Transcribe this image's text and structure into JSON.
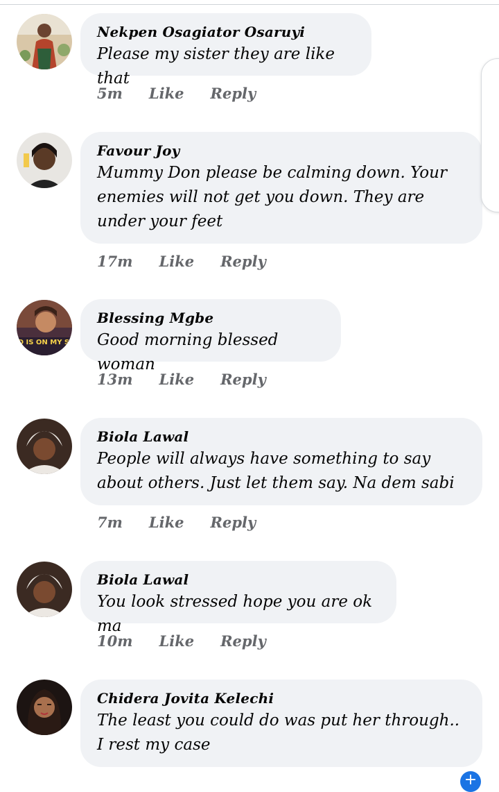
{
  "comments": [
    {
      "author": "Nekpen Osagiator Osaruyi",
      "text": "Please my sister they are like that",
      "time": "5m",
      "like": "Like",
      "reply": "Reply"
    },
    {
      "author": "Favour Joy",
      "text": "Mummy Don please be calming down. Your enemies will not get you down. They are under your feet",
      "time": "17m",
      "like": "Like",
      "reply": "Reply"
    },
    {
      "author": "Blessing Mgbe",
      "text": "Good morning blessed woman",
      "time": "13m",
      "like": "Like",
      "reply": "Reply",
      "avatar_caption": "GOD IS ON MY SIDE"
    },
    {
      "author": "Biola Lawal",
      "text": "People will always have something to say about others. Just let them say. Na dem sabi",
      "time": "7m",
      "like": "Like",
      "reply": "Reply"
    },
    {
      "author": "Biola Lawal",
      "text": "You look stressed hope you are ok ma",
      "time": "10m",
      "like": "Like",
      "reply": "Reply"
    },
    {
      "author": "Chidera Jovita Kelechi",
      "text": "The least you could do was put her through.. I rest my case",
      "time": "",
      "like": "",
      "reply": ""
    }
  ],
  "colors": {
    "bubble": "#f0f2f5",
    "meta": "#65676b",
    "accent": "#1b74e4"
  }
}
